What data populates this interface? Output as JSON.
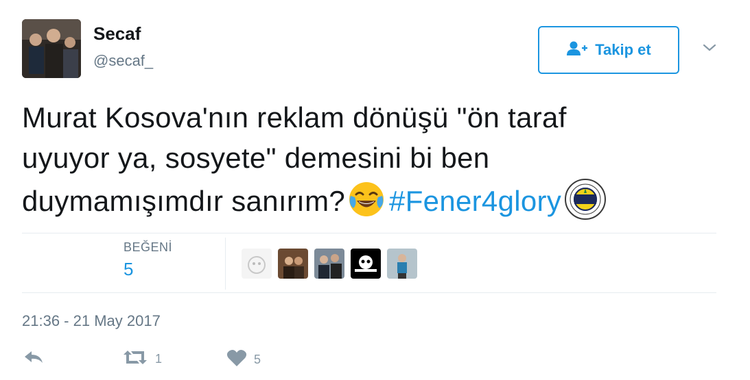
{
  "user": {
    "name": "Secaf",
    "handle": "@secaf_"
  },
  "follow_button": {
    "label": "Takip et",
    "icon": "user-follow-icon"
  },
  "tweet": {
    "text_line1": "Murat Kosova'nın reklam dönüşü \"ön taraf",
    "text_line2": "uyuyor ya, sosyete\" demesini bi ben",
    "text_line3": "duymamışımdır sanırım?",
    "emoji": "face-with-tears-of-joy",
    "hashtag": "#Fener4glory"
  },
  "stats": {
    "likes_label": "BEĞENİ",
    "likes_count": "5"
  },
  "timestamp": "21:36 - 21 May 2017",
  "actions": {
    "reply_icon": "reply-icon",
    "retweet_icon": "retweet-icon",
    "retweet_count": "1",
    "like_icon": "heart-icon",
    "like_count": "5"
  },
  "colors": {
    "accent": "#1b95e0",
    "text": "#14171a",
    "muted": "#657786",
    "icon_muted": "#8899a6",
    "border": "#e6ecf0"
  }
}
